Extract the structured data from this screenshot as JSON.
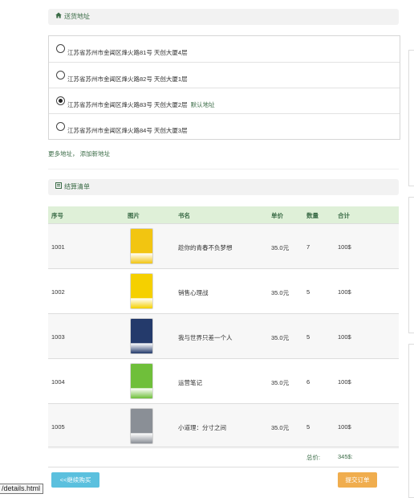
{
  "address_section": {
    "title": "送货地址",
    "icon": "home-icon"
  },
  "addresses": [
    {
      "text": "江苏省苏州市金阊区烽火路81号 天创大厦4层",
      "checked": false,
      "tag": ""
    },
    {
      "text": "江苏省苏州市金阊区烽火路82号 天创大厦1层",
      "checked": false,
      "tag": ""
    },
    {
      "text": "江苏省苏州市金阊区烽火路83号 天创大厦2层",
      "checked": true,
      "tag": "默认地址"
    },
    {
      "text": "江苏省苏州市金阊区烽火路84号 天创大厦3层",
      "checked": false,
      "tag": ""
    }
  ],
  "address_links": {
    "more": "更多地址",
    "sep": "，",
    "add": "添加新地址"
  },
  "checkout_section": {
    "title": "结算清单",
    "icon": "list-icon"
  },
  "table": {
    "headers": {
      "id": "序号",
      "image": "图片",
      "title": "书名",
      "price": "单价",
      "qty": "数量",
      "total": "合计"
    },
    "rows": [
      {
        "id": "1001",
        "title": "趁你的青春不负梦想",
        "price": "35.0元",
        "qty": "7",
        "total": "100$",
        "cover": "#f2c511"
      },
      {
        "id": "1002",
        "title": "销售心理战",
        "price": "35.0元",
        "qty": "5",
        "total": "100$",
        "cover": "#f5d000"
      },
      {
        "id": "1003",
        "title": "我与世界只差一个人",
        "price": "35.0元",
        "qty": "5",
        "total": "100$",
        "cover": "#243a6b"
      },
      {
        "id": "1004",
        "title": "运营笔记",
        "price": "35.0元",
        "qty": "6",
        "total": "100$",
        "cover": "#6fbf3a"
      },
      {
        "id": "1005",
        "title": "小道理：分寸之间",
        "price": "35.0元",
        "qty": "5",
        "total": "100$",
        "cover": "#8a8f96"
      }
    ]
  },
  "summary": {
    "label": "总价:",
    "value": "345$:"
  },
  "buttons": {
    "continue": "<<继续购买",
    "submit": "提交订单",
    "continue_color": "#5bc0de",
    "submit_color": "#f0ad4e"
  },
  "status_tooltip": "/details.html"
}
